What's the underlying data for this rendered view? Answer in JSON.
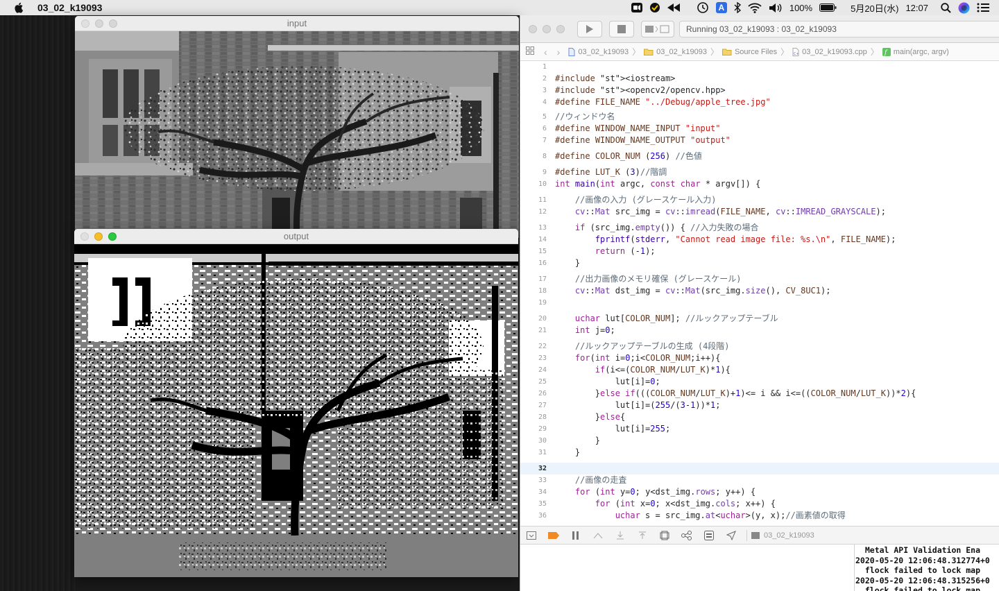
{
  "menubar": {
    "app_name": "03_02_k19093",
    "battery": "100%",
    "date": "5月20日(水)",
    "time": "12:07",
    "icons": [
      "apple-icon",
      "zoom-icon",
      "norton-icon",
      "rewind-icon",
      "time-machine-icon",
      "input-method-icon",
      "bluetooth-icon",
      "wifi-icon",
      "volume-icon",
      "battery-icon",
      "spotlight-icon",
      "siri-icon",
      "control-center-icon"
    ],
    "input_method_label": "A"
  },
  "windows": {
    "input": {
      "title": "input"
    },
    "output": {
      "title": "output"
    }
  },
  "xcode": {
    "status": "Running 03_02_k19093 : 03_02_k19093",
    "breadcrumbs": [
      "03_02_k19093",
      "03_02_k19093",
      "Source Files",
      "03_02_k19093.cpp",
      "main(argc, argv)"
    ],
    "current_line": 32,
    "scheme_label": "03_02_k19093",
    "console_lines": [
      "  Metal API Validation Ena",
      "2020-05-20 12:06:48.312774+0",
      "  flock failed to lock map",
      "2020-05-20 12:06:48.315256+0",
      "  flock failed to lock map"
    ]
  },
  "code_lines": [
    {
      "n": "1",
      "t": ""
    },
    {
      "n": "2",
      "t": "#include <iostream>"
    },
    {
      "n": "3",
      "t": "#include <opencv2/opencv.hpp>"
    },
    {
      "n": "4",
      "t": "#define FILE_NAME \"../Debug/apple_tree.jpg\""
    },
    {
      "n": "5",
      "t": "//ウィンドウ名"
    },
    {
      "n": "6",
      "t": "#define WINDOW_NAME_INPUT \"input\""
    },
    {
      "n": "7",
      "t": "#define WINDOW_NAME_OUTPUT \"output\""
    },
    {
      "n": "8",
      "t": "#define COLOR_NUM (256) //色値"
    },
    {
      "n": "9",
      "t": "#define LUT_K (3)//階調"
    },
    {
      "n": "10",
      "t": "int main(int argc, const char * argv[]) {"
    },
    {
      "n": "11",
      "t": "    //画像の入力 (グレースケール入力)"
    },
    {
      "n": "12",
      "t": "    cv::Mat src_img = cv::imread(FILE_NAME, cv::IMREAD_GRAYSCALE);"
    },
    {
      "n": "13",
      "t": "    if (src_img.empty()) { //入力失敗の場合"
    },
    {
      "n": "14",
      "t": "        fprintf(stderr, \"Cannot read image file: %s.\\n\", FILE_NAME);"
    },
    {
      "n": "15",
      "t": "        return (-1);"
    },
    {
      "n": "16",
      "t": "    }"
    },
    {
      "n": "17",
      "t": "    //出力画像のメモリ確保 (グレースケール)"
    },
    {
      "n": "18",
      "t": "    cv::Mat dst_img = cv::Mat(src_img.size(), CV_8UC1);"
    },
    {
      "n": "19",
      "t": ""
    },
    {
      "n": "20",
      "t": "    uchar lut[COLOR_NUM]; //ルックアップテーブル"
    },
    {
      "n": "21",
      "t": "    int j=0;"
    },
    {
      "n": "22",
      "t": "    //ルックアップテーブルの生成 (4段階)"
    },
    {
      "n": "23",
      "t": "    for(int i=0;i<COLOR_NUM;i++){"
    },
    {
      "n": "24",
      "t": "        if(i<=(COLOR_NUM/LUT_K)*1){"
    },
    {
      "n": "25",
      "t": "            lut[i]=0;"
    },
    {
      "n": "26",
      "t": "        }else if(((COLOR_NUM/LUT_K)+1)<= i && i<=((COLOR_NUM/LUT_K))*2){"
    },
    {
      "n": "27",
      "t": "            lut[i]=(255/(3-1))*1;"
    },
    {
      "n": "28",
      "t": "        }else{"
    },
    {
      "n": "29",
      "t": "            lut[i]=255;"
    },
    {
      "n": "30",
      "t": "        }"
    },
    {
      "n": "31",
      "t": "    }"
    },
    {
      "n": "32",
      "t": ""
    },
    {
      "n": "33",
      "t": "    //画像の走査"
    },
    {
      "n": "34",
      "t": "    for (int y=0; y<dst_img.rows; y++) {"
    },
    {
      "n": "35",
      "t": "        for (int x=0; x<dst_img.cols; x++) {"
    },
    {
      "n": "36",
      "t": "            uchar s = src_img.at<uchar>(y, x);//画素値の取得"
    }
  ]
}
